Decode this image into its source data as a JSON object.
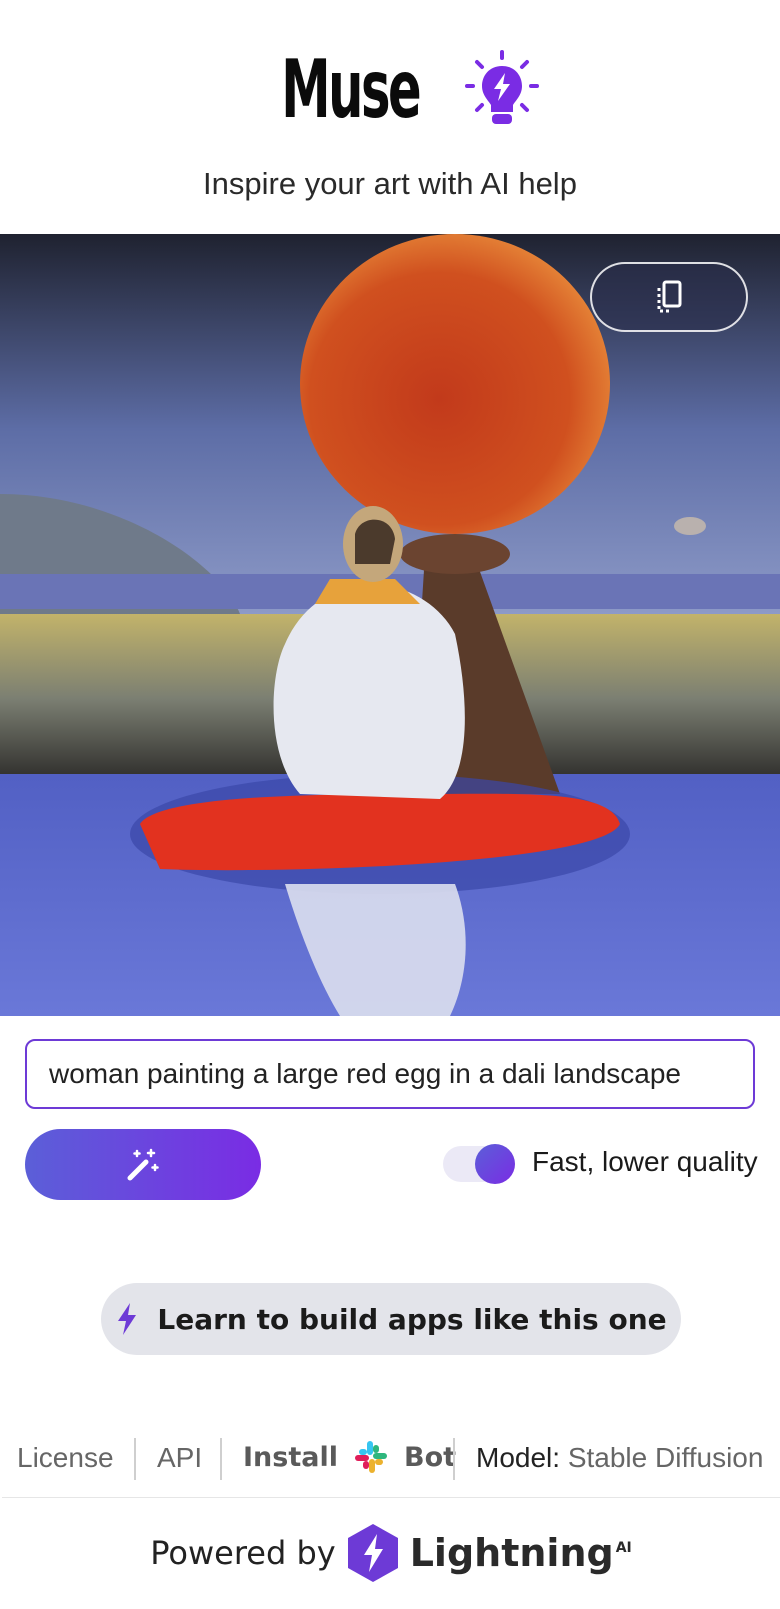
{
  "header": {
    "title": "Muse",
    "subtitle": "Inspire your art with AI help"
  },
  "image": {
    "icon": "copy-icon"
  },
  "prompt": {
    "value": "woman painting a large red egg in a dali landscape"
  },
  "generate": {
    "icon": "magic-wand-icon"
  },
  "toggle": {
    "label": "Fast, lower quality",
    "on": true
  },
  "learn": {
    "label": "Learn to build apps like this one",
    "icon": "lightning-icon"
  },
  "footer": {
    "license": "License",
    "api": "API",
    "install": "Install",
    "bot": "Bot",
    "model_label": "Model:",
    "model_value": "Stable Diffusion"
  },
  "powered": {
    "text": "Powered by",
    "brand": "Lightning",
    "brand_sup": "AI"
  },
  "colors": {
    "accent": "#7a2ce4",
    "accent2": "#5b5fd8"
  }
}
